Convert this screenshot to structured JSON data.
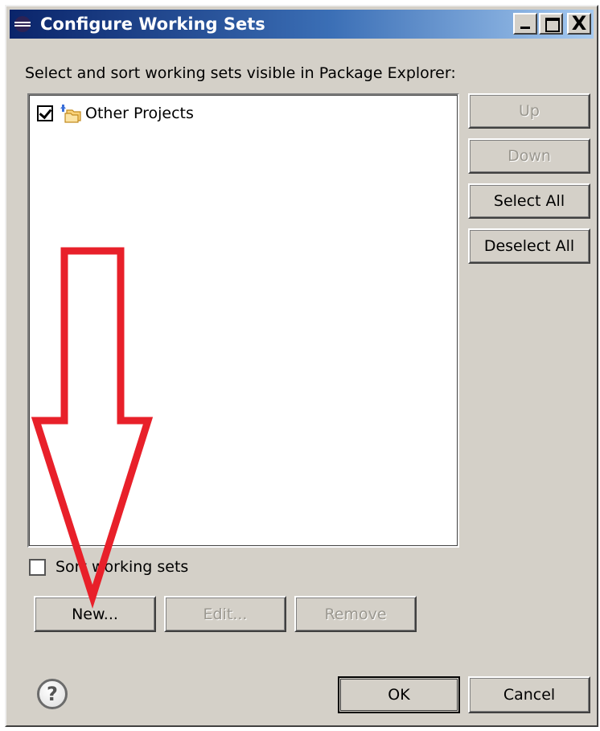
{
  "window": {
    "title": "Configure Working Sets",
    "title_icon": "eclipse-icon",
    "controls": {
      "minimize": "_",
      "maximize": "□",
      "close": "X"
    }
  },
  "instruction": "Select and sort working sets visible in Package Explorer:",
  "working_sets": [
    {
      "label": "Other Projects",
      "checked": true,
      "icon": "working-set-folder-icon"
    }
  ],
  "side_buttons": {
    "up": "Up",
    "down": "Down",
    "select_all": "Select All",
    "deselect_all": "Deselect All"
  },
  "sort": {
    "label": "Sort working sets",
    "checked": false
  },
  "bottom_buttons": {
    "new": "New...",
    "edit": "Edit...",
    "remove": "Remove"
  },
  "footer": {
    "help": "?",
    "ok": "OK",
    "cancel": "Cancel"
  },
  "annotation": {
    "color": "#e8202a",
    "shape": "down-arrow"
  }
}
